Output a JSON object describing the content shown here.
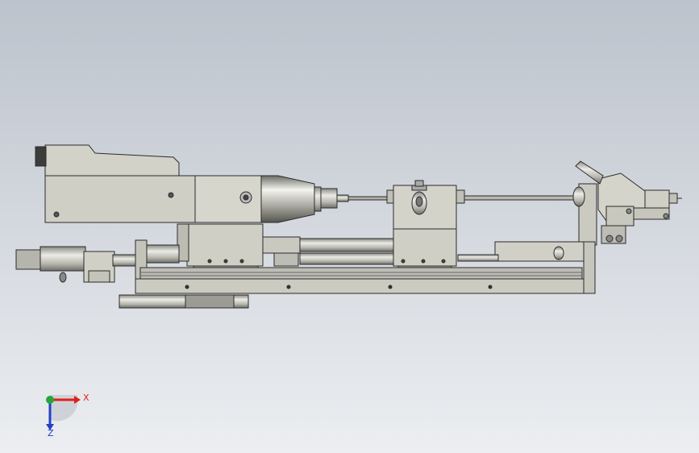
{
  "viewport": {
    "background_top": "#bcc3cc",
    "background_bottom": "#eceef1",
    "part_fill": "#cfcfc6",
    "part_fill_dark": "#a9a99f",
    "part_shade": "#8c8c84",
    "edge_color": "#2b2b2b"
  },
  "triad": {
    "x_label": "X",
    "z_label": "Z",
    "x_color": "#e0201b",
    "y_color": "#23a63a",
    "z_color": "#2340c8"
  }
}
